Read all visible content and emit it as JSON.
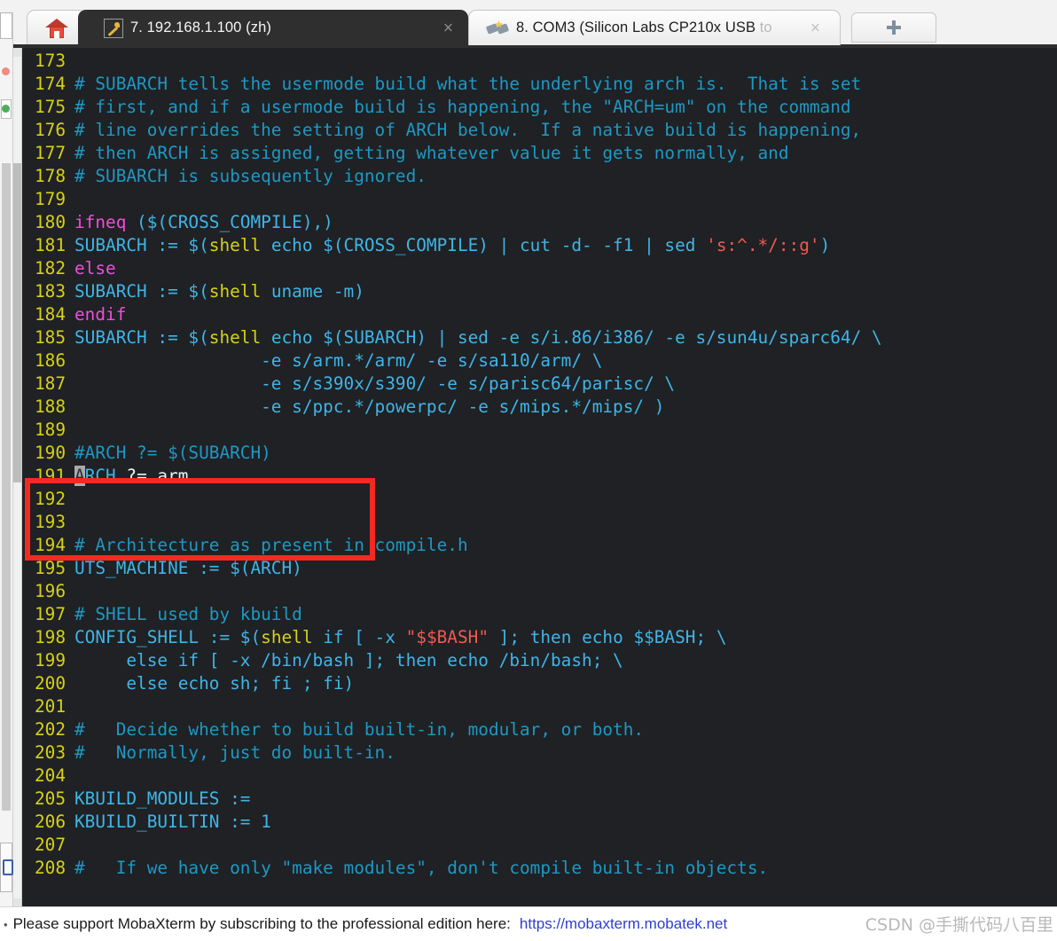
{
  "tabs": {
    "home": {
      "name": "home-tab",
      "icon": "home-icon"
    },
    "active": {
      "icon": "wrench-icon",
      "label": "7. 192.168.1.100 (zh)",
      "close": "×"
    },
    "inactive": {
      "icon": "serial-plug-icon",
      "label_main": "8. COM3  (Silicon Labs CP210x USB",
      "label_faded": " to",
      "close": "×"
    },
    "new_tab": {
      "label": "+",
      "icon": "plus-icon"
    }
  },
  "status": {
    "caret": "•",
    "message": "Please support MobaXterm by subscribing to the professional edition here:",
    "link": "https://mobaxterm.mobatek.net",
    "watermark": "CSDN @手撕代码八百里"
  },
  "editor": {
    "first_line": 173,
    "cursor_line": 191,
    "cursor_char": "A",
    "lines": [
      {
        "n": "173",
        "parts": []
      },
      {
        "n": "174",
        "parts": [
          {
            "t": "# SUBARCH tells the usermode build what the underlying arch is.  That is set",
            "c": "c-cmt"
          }
        ]
      },
      {
        "n": "175",
        "parts": [
          {
            "t": "# first, and if a usermode build is happening, the \"ARCH=um\" on the command",
            "c": "c-cmt"
          }
        ]
      },
      {
        "n": "176",
        "parts": [
          {
            "t": "# line overrides the setting of ARCH below.  If a native build is happening,",
            "c": "c-cmt"
          }
        ]
      },
      {
        "n": "177",
        "parts": [
          {
            "t": "# then ARCH is assigned, getting whatever value it gets normally, and",
            "c": "c-cmt"
          }
        ]
      },
      {
        "n": "178",
        "parts": [
          {
            "t": "# SUBARCH is subsequently ignored.",
            "c": "c-cmt"
          }
        ]
      },
      {
        "n": "179",
        "parts": []
      },
      {
        "n": "180",
        "parts": [
          {
            "t": "ifneq ",
            "c": "c-kw"
          },
          {
            "t": "($(CROSS_COMPILE),)",
            "c": "c-txt"
          }
        ]
      },
      {
        "n": "181",
        "parts": [
          {
            "t": "SUBARCH := $(",
            "c": "c-txt"
          },
          {
            "t": "shell",
            "c": "c-fn"
          },
          {
            "t": " echo $(CROSS_COMPILE) | cut -d- -f1 | sed ",
            "c": "c-txt"
          },
          {
            "t": "'s:^.*/::g'",
            "c": "c-str"
          },
          {
            "t": ")",
            "c": "c-txt"
          }
        ]
      },
      {
        "n": "182",
        "parts": [
          {
            "t": "else",
            "c": "c-kw"
          }
        ]
      },
      {
        "n": "183",
        "parts": [
          {
            "t": "SUBARCH := $(",
            "c": "c-txt"
          },
          {
            "t": "shell",
            "c": "c-fn"
          },
          {
            "t": " uname -m)",
            "c": "c-txt"
          }
        ]
      },
      {
        "n": "184",
        "parts": [
          {
            "t": "endif",
            "c": "c-kw"
          }
        ]
      },
      {
        "n": "185",
        "parts": [
          {
            "t": "SUBARCH := $(",
            "c": "c-txt"
          },
          {
            "t": "shell",
            "c": "c-fn"
          },
          {
            "t": " echo $(SUBARCH) | sed -e s/i.86/i386/ -e s/sun4u/sparc64/ \\",
            "c": "c-txt"
          }
        ]
      },
      {
        "n": "186",
        "parts": [
          {
            "t": "                  -e s/arm.*/arm/ -e s/sa110/arm/ \\",
            "c": "c-txt"
          }
        ]
      },
      {
        "n": "187",
        "parts": [
          {
            "t": "                  -e s/s390x/s390/ -e s/parisc64/parisc/ \\",
            "c": "c-txt"
          }
        ]
      },
      {
        "n": "188",
        "parts": [
          {
            "t": "                  -e s/ppc.*/powerpc/ -e s/mips.*/mips/ )",
            "c": "c-txt"
          }
        ]
      },
      {
        "n": "189",
        "parts": []
      },
      {
        "n": "190",
        "parts": [
          {
            "t": "#ARCH ?= $(SUBARCH)",
            "c": "c-cmt"
          }
        ]
      },
      {
        "n": "191",
        "parts": [
          {
            "t": "A",
            "c": "c-var cursor"
          },
          {
            "t": "RCH",
            "c": "c-var"
          },
          {
            "t": " ?= arm",
            "c": "c-wht"
          }
        ]
      },
      {
        "n": "192",
        "parts": []
      },
      {
        "n": "193",
        "parts": []
      },
      {
        "n": "194",
        "parts": [
          {
            "t": "# Architecture as present in compile.h",
            "c": "c-cmt"
          }
        ]
      },
      {
        "n": "195",
        "parts": [
          {
            "t": "UTS_MACHINE := $(ARCH)",
            "c": "c-txt"
          }
        ]
      },
      {
        "n": "196",
        "parts": []
      },
      {
        "n": "197",
        "parts": [
          {
            "t": "# SHELL used by kbuild",
            "c": "c-cmt"
          }
        ]
      },
      {
        "n": "198",
        "parts": [
          {
            "t": "CONFIG_SHELL := $(",
            "c": "c-txt"
          },
          {
            "t": "shell",
            "c": "c-fn"
          },
          {
            "t": " if [ -x ",
            "c": "c-txt"
          },
          {
            "t": "\"$$BASH\"",
            "c": "c-str"
          },
          {
            "t": " ]; then echo $$BASH; \\",
            "c": "c-txt"
          }
        ]
      },
      {
        "n": "199",
        "parts": [
          {
            "t": "     else if [ -x /bin/bash ]; then echo /bin/bash; \\",
            "c": "c-txt"
          }
        ]
      },
      {
        "n": "200",
        "parts": [
          {
            "t": "     else echo sh; fi ; fi)",
            "c": "c-txt"
          }
        ]
      },
      {
        "n": "201",
        "parts": []
      },
      {
        "n": "202",
        "parts": [
          {
            "t": "#   Decide whether to build built-in, modular, or both.",
            "c": "c-cmt"
          }
        ]
      },
      {
        "n": "203",
        "parts": [
          {
            "t": "#   Normally, just do built-in.",
            "c": "c-cmt"
          }
        ]
      },
      {
        "n": "204",
        "parts": []
      },
      {
        "n": "205",
        "parts": [
          {
            "t": "KBUILD_MODULES :=",
            "c": "c-txt"
          }
        ]
      },
      {
        "n": "206",
        "parts": [
          {
            "t": "KBUILD_BUILTIN := 1",
            "c": "c-txt"
          }
        ]
      },
      {
        "n": "207",
        "parts": []
      },
      {
        "n": "208",
        "parts": [
          {
            "t": "#   If we have only \"make modules\", don't compile built-in objects.",
            "c": "c-cmt"
          }
        ]
      }
    ]
  },
  "colors": {
    "terminal_bg": "#1f2124",
    "line_number": "#d7d118",
    "comment": "#1e98c4",
    "text": "#3fb5e8",
    "keyword": "#ef4edb",
    "function": "#d7d118",
    "string": "#f4584f",
    "white_text": "#f1f1f1",
    "annotation_box": "#f32a21",
    "tab_active_bg": "#2f2f2f",
    "link": "#2f3dd4"
  },
  "annotation": {
    "box_label": "highlighted-arch-setting",
    "covers_lines": [
      "190",
      "191",
      "192"
    ]
  }
}
